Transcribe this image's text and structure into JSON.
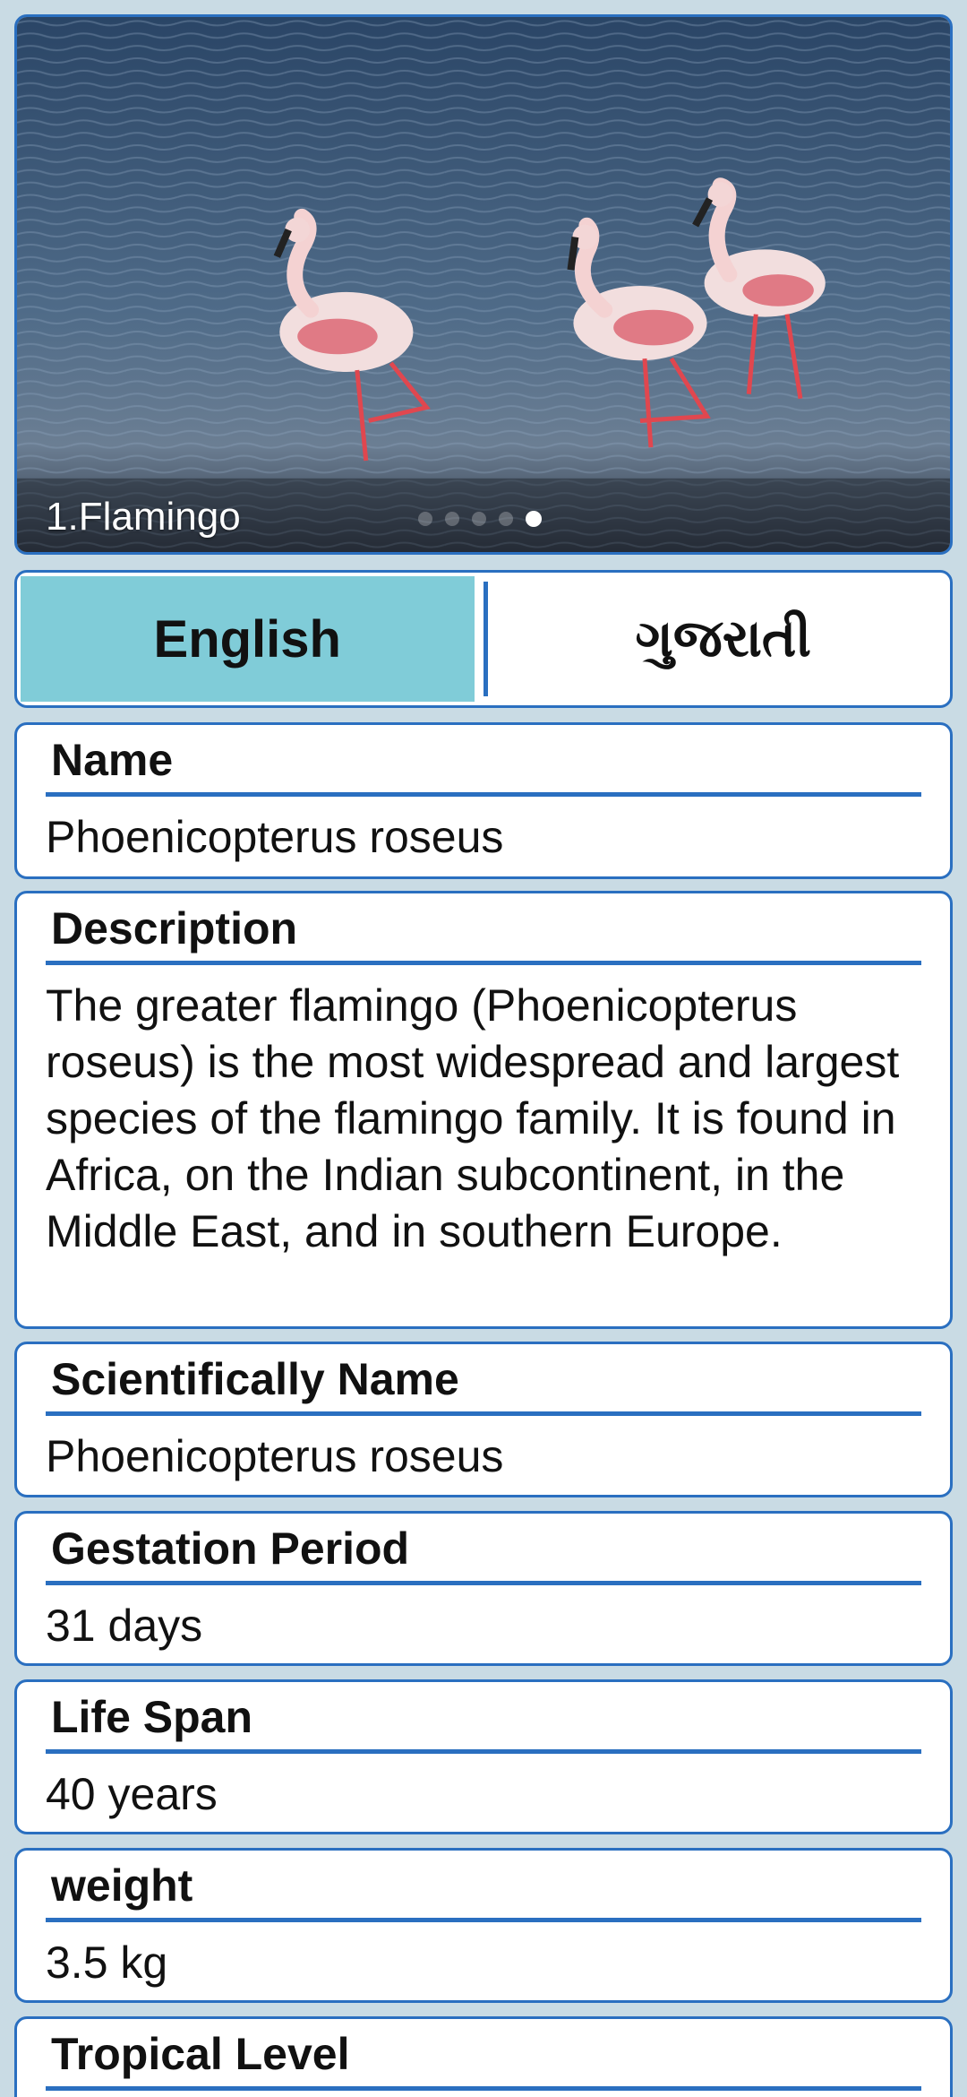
{
  "hero": {
    "caption": "1.Flamingo",
    "slides_total": 5,
    "active_slide": 5
  },
  "language": {
    "options": [
      "English",
      "ગુજરાતી"
    ],
    "selected": "English"
  },
  "details": {
    "name": {
      "title": "Name",
      "value": "Phoenicopterus roseus"
    },
    "description": {
      "title": "Description",
      "value": "The greater flamingo (Phoenicopterus roseus) is the most widespread and largest species of the flamingo family. It is found in Africa, on the Indian subcontinent, in the Middle East, and in southern Europe."
    },
    "scientific_name": {
      "title": "Scientifically Name",
      "value": "Phoenicopterus roseus"
    },
    "gestation": {
      "title": "Gestation Period",
      "value": "31 days"
    },
    "lifespan": {
      "title": "Life Span",
      "value": "40 years"
    },
    "weight": {
      "title": "weight",
      "value": "3.5 kg"
    },
    "tropical_level": {
      "title": "Tropical Level"
    }
  },
  "colors": {
    "accent": "#2a6fc0",
    "selected_tab": "#80ccd8",
    "background": "#c9dbe4"
  }
}
